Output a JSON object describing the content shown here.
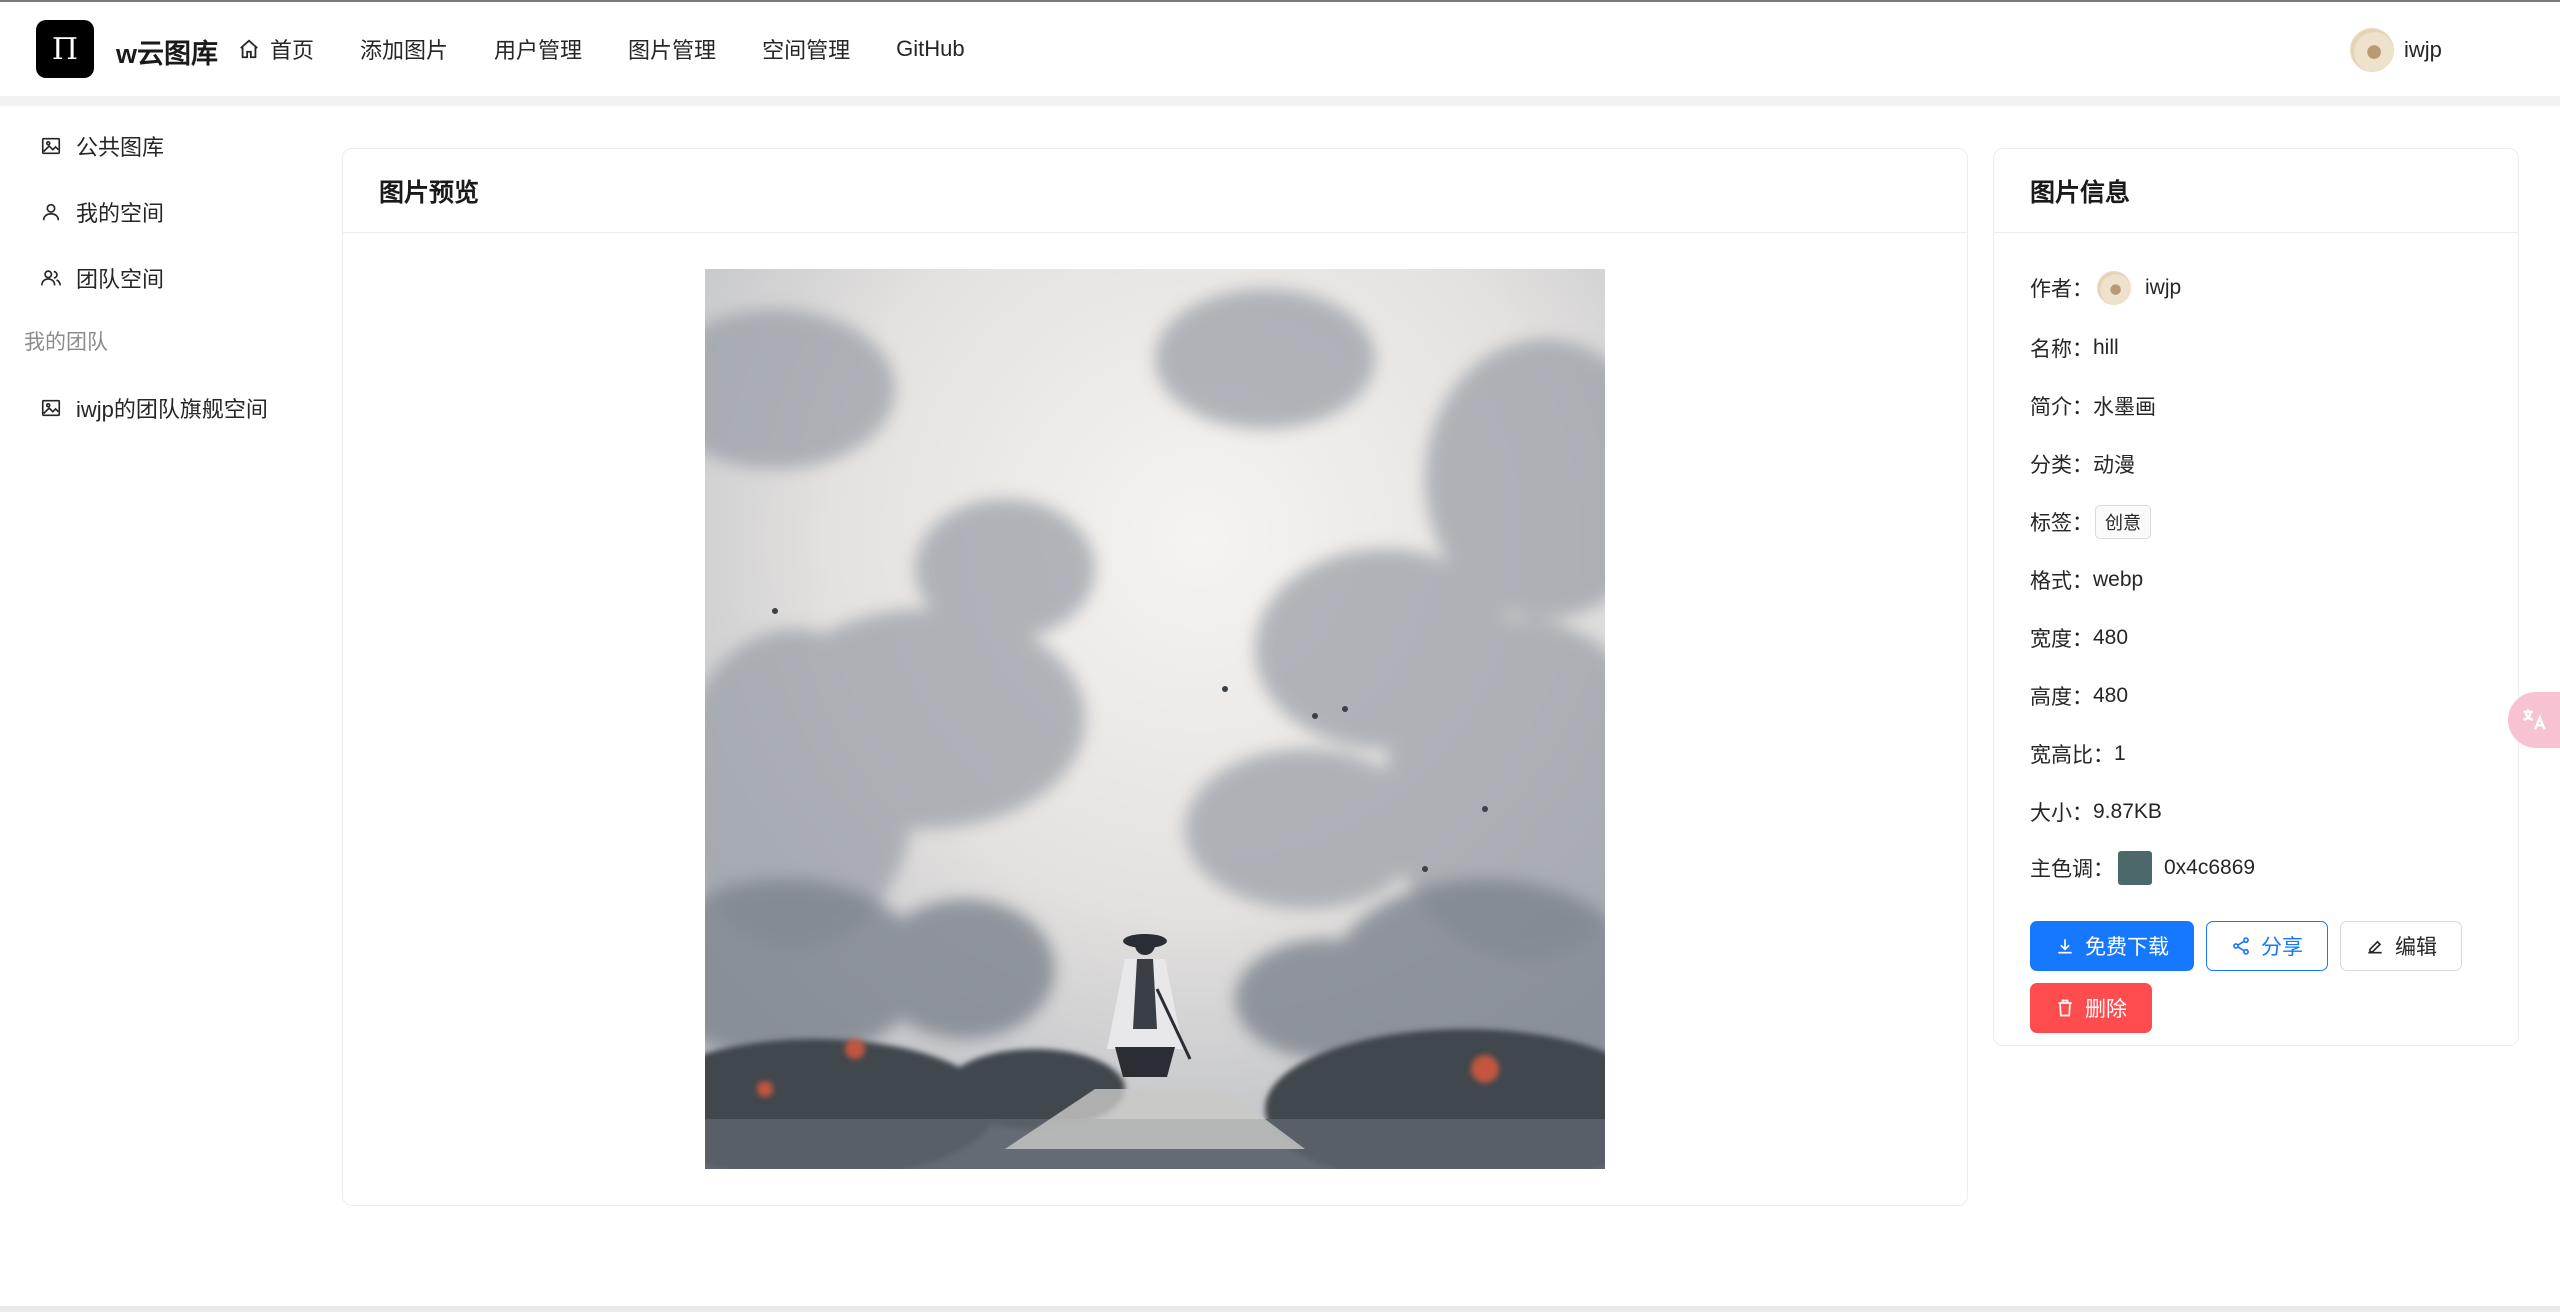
{
  "header": {
    "logo_glyph": "Π",
    "brand": "w云图库",
    "nav": [
      "首页",
      "添加图片",
      "用户管理",
      "图片管理",
      "空间管理",
      "GitHub"
    ],
    "user_name": "iwjp"
  },
  "sidebar": {
    "items": [
      {
        "label": "公共图库",
        "icon": "picture-icon"
      },
      {
        "label": "我的空间",
        "icon": "user-icon"
      },
      {
        "label": "团队空间",
        "icon": "team-icon"
      }
    ],
    "group_title": "我的团队",
    "team_items": [
      {
        "label": "iwjp的团队旗舰空间",
        "icon": "picture-icon"
      }
    ]
  },
  "preview": {
    "title": "图片预览"
  },
  "info": {
    "title": "图片信息",
    "author_label": "作者：",
    "author": "iwjp",
    "name_label": "名称：",
    "name": "hill",
    "intro_label": "简介：",
    "intro": "水墨画",
    "category_label": "分类：",
    "category": "动漫",
    "tags_label": "标签：",
    "tags": [
      "创意"
    ],
    "format_label": "格式：",
    "format": "webp",
    "width_label": "宽度：",
    "width": "480",
    "height_label": "高度：",
    "height": "480",
    "ratio_label": "宽高比：",
    "ratio": "1",
    "size_label": "大小：",
    "size": "9.87KB",
    "color_label": "主色调：",
    "color": "0x4c6869",
    "color_hex": "#4c6869"
  },
  "actions": {
    "download": "免费下载",
    "share": "分享",
    "edit": "编辑",
    "delete": "删除"
  },
  "colors": {
    "primary": "#1677ff",
    "danger": "#ff4d4f"
  }
}
